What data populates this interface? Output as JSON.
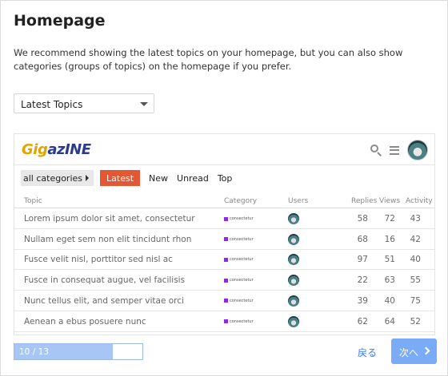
{
  "page": {
    "title": "Homepage",
    "description": "We recommend showing the latest topics on your homepage, but you can also show categories (groups of topics) on the homepage if you prefer."
  },
  "homepage_select": {
    "value": "Latest Topics"
  },
  "preview": {
    "logo_part1": "Gig",
    "logo_part2": "azINE",
    "nav": {
      "all_categories": "all categories",
      "tabs": [
        "Latest",
        "New",
        "Unread",
        "Top"
      ]
    },
    "columns": [
      "Topic",
      "Category",
      "Users",
      "Replies",
      "Views",
      "Activity"
    ],
    "rows": [
      {
        "topic": "Lorem ipsum dolor sit amet, consectetur",
        "category": "consectetur",
        "replies": "58",
        "views": "72",
        "activity": "43"
      },
      {
        "topic": "Nullam eget sem non elit tincidunt rhon",
        "category": "consectetur",
        "replies": "68",
        "views": "16",
        "activity": "42"
      },
      {
        "topic": "Fusce velit nisl, porttitor sed nisl ac",
        "category": "consectetur",
        "replies": "97",
        "views": "51",
        "activity": "40"
      },
      {
        "topic": "Fusce in consequat augue, vel facilisis",
        "category": "consectetur",
        "replies": "22",
        "views": "63",
        "activity": "55"
      },
      {
        "topic": "Nunc tellus elit, and semper vitae orci",
        "category": "consectetur",
        "replies": "39",
        "views": "40",
        "activity": "75"
      },
      {
        "topic": "Aenean a ebus posuere nunc",
        "category": "consectetur",
        "replies": "62",
        "views": "64",
        "activity": "52"
      }
    ]
  },
  "footer": {
    "progress_text": "10 / 13",
    "progress_fraction": 0.77,
    "back_label": "戻る",
    "next_label": "次へ"
  },
  "colors": {
    "accent_tab": "#e45735",
    "primary_button": "#7baaf7",
    "progress_fill": "#a8c6f5",
    "link": "#3b78e7",
    "category_swatch": "#8a2be2"
  }
}
